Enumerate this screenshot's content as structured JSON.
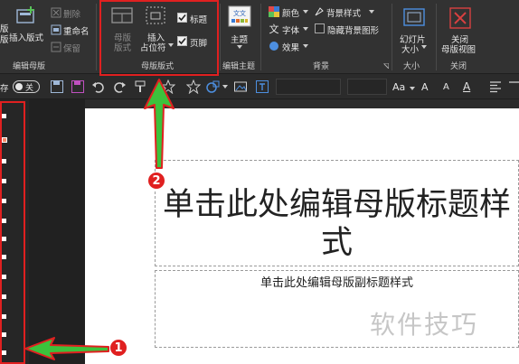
{
  "ribbon": {
    "group_edit_master": {
      "label": "编辑母版",
      "insert_layout": "插入版式",
      "delete": "删除",
      "rename": "重命名",
      "preserve": "保留",
      "insert_slide_master_partial": "版"
    },
    "group_master_layout": {
      "label": "母版版式",
      "master_layout_line1": "母版",
      "master_layout_line2": "版式",
      "insert_placeholder_line1": "插入",
      "insert_placeholder_line2": "占位符",
      "title_checkbox": "标题",
      "title_checked": true,
      "footer_checkbox": "页脚",
      "footer_checked": true
    },
    "group_edit_theme": {
      "label": "编辑主题",
      "theme": "主题"
    },
    "group_background": {
      "label": "背景",
      "colors": "颜色",
      "fonts": "字体",
      "effects": "效果",
      "background_styles": "背景样式",
      "hide_background_graphics": "隐藏背景图形",
      "hide_checked": false
    },
    "group_size": {
      "label": "大小",
      "slide_size_line1": "幻灯片",
      "slide_size_line2": "大小"
    },
    "group_close": {
      "label": "关闭",
      "close_line1": "关闭",
      "close_line2": "母版视图"
    }
  },
  "qat": {
    "autosave_label": "存",
    "toggle_state": "关",
    "font_size_glyph_large": "Aa",
    "increase_font": "A",
    "decrease_font": "A",
    "font_color": "A"
  },
  "slide": {
    "title_line1": "单击此处编辑母版标题样",
    "title_line2": "式",
    "subtitle": "单击此处编辑母版副标题样式",
    "watermark": "软件技巧"
  },
  "annotations": {
    "badge1": "1",
    "badge2": "2",
    "accent": "#e02020",
    "arrow_green": "#3cc23c"
  }
}
